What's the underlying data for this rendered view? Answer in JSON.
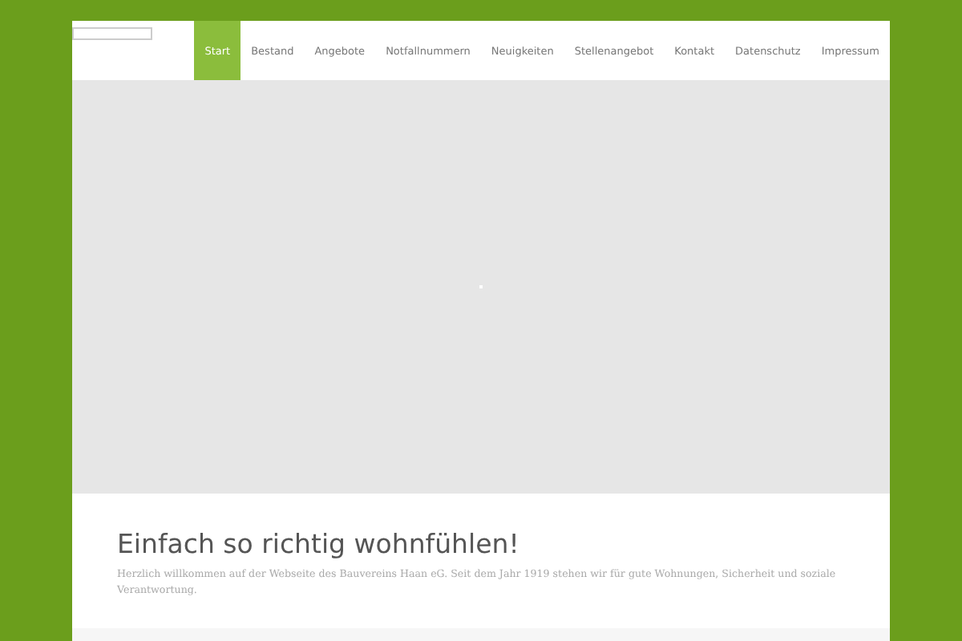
{
  "nav": [
    {
      "label": "Start",
      "selected": true
    },
    {
      "label": "Bestand",
      "selected": false
    },
    {
      "label": "Angebote",
      "selected": false
    },
    {
      "label": "Notfallnummern",
      "selected": false
    },
    {
      "label": "Neuigkeiten",
      "selected": false
    },
    {
      "label": "Stellenangebot",
      "selected": false
    },
    {
      "label": "Kontakt",
      "selected": false
    },
    {
      "label": "Datenschutz",
      "selected": false
    },
    {
      "label": "Impressum",
      "selected": false
    }
  ],
  "intro": {
    "heading": "Einfach so richtig wohnfühlen!",
    "text": "Herzlich willkommen auf der Webseite des Bauvereins Haan eG. Seit dem Jahr 1919 stehen wir für gute Wohnungen, Sicherheit und soziale Verantwortung."
  }
}
